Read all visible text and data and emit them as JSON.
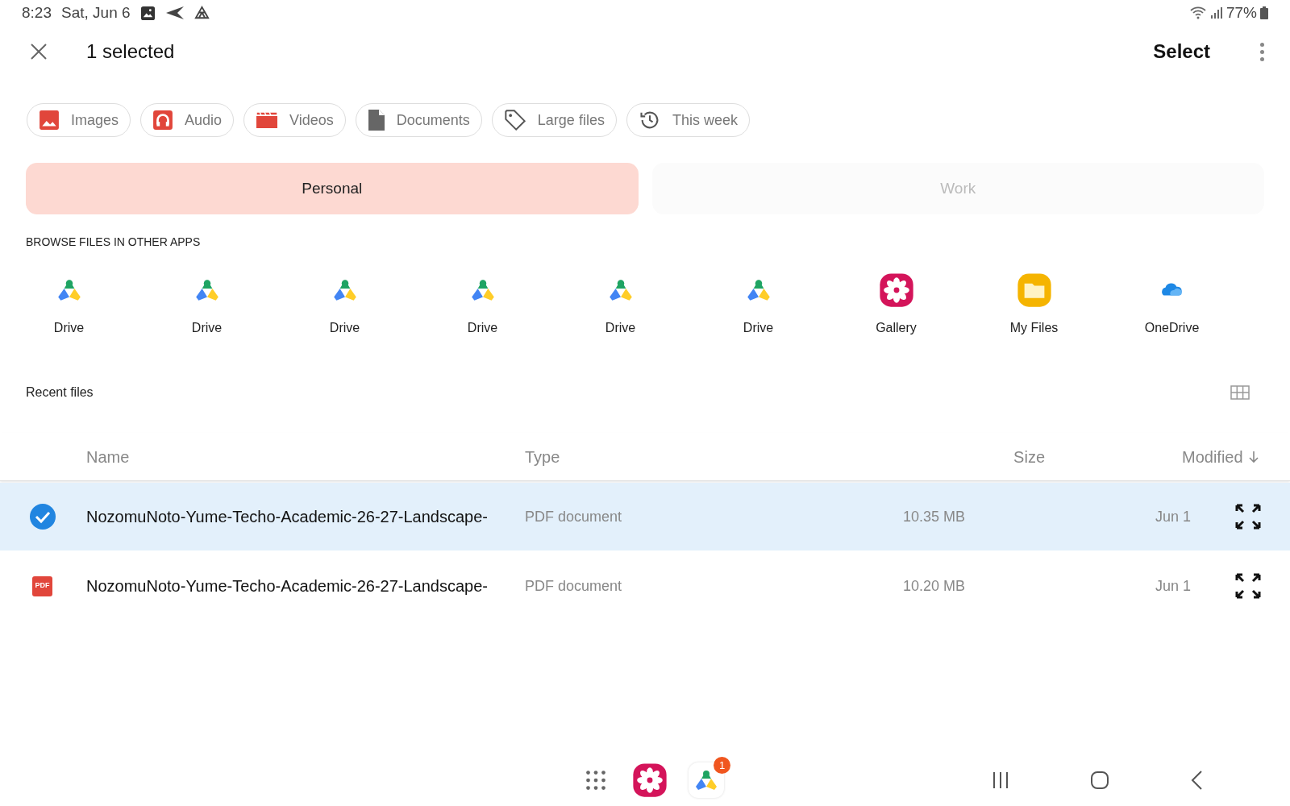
{
  "status_bar": {
    "time": "8:23",
    "date": "Sat, Jun 6",
    "battery": "77%"
  },
  "header": {
    "title": "1 selected",
    "action": "Select"
  },
  "chips": [
    {
      "label": "Images",
      "kind": "images"
    },
    {
      "label": "Audio",
      "kind": "audio"
    },
    {
      "label": "Videos",
      "kind": "videos"
    },
    {
      "label": "Documents",
      "kind": "documents"
    },
    {
      "label": "Large files",
      "kind": "tag"
    },
    {
      "label": "This week",
      "kind": "history"
    }
  ],
  "tabs": [
    {
      "label": "Personal",
      "selected": true
    },
    {
      "label": "Work",
      "selected": false
    }
  ],
  "apps_section": {
    "title": "BROWSE FILES IN OTHER APPS",
    "apps": [
      {
        "label": "Drive",
        "kind": "drive"
      },
      {
        "label": "Drive",
        "kind": "drive"
      },
      {
        "label": "Drive",
        "kind": "drive"
      },
      {
        "label": "Drive",
        "kind": "drive"
      },
      {
        "label": "Drive",
        "kind": "drive"
      },
      {
        "label": "Drive",
        "kind": "drive"
      },
      {
        "label": "Gallery",
        "kind": "gallery"
      },
      {
        "label": "My Files",
        "kind": "myfiles"
      },
      {
        "label": "OneDrive",
        "kind": "onedrive"
      }
    ]
  },
  "recent": {
    "title": "Recent files",
    "columns": [
      "Name",
      "Type",
      "Size",
      "Modified"
    ],
    "rows": [
      {
        "name": "NozomuNoto-Yume-Techo-Academic-26-27-Landscape-",
        "type": "PDF document",
        "size": "10.35 MB",
        "modified": "Jun 1",
        "selected": true
      },
      {
        "name": "NozomuNoto-Yume-Techo-Academic-26-27-Landscape-",
        "type": "PDF document",
        "size": "10.20 MB",
        "modified": "Jun 1",
        "selected": false,
        "icon_label": "PDF"
      }
    ]
  },
  "dock": {
    "apps": [
      {
        "kind": "apps"
      },
      {
        "kind": "gallery"
      },
      {
        "kind": "drive",
        "badge": "1"
      }
    ]
  }
}
